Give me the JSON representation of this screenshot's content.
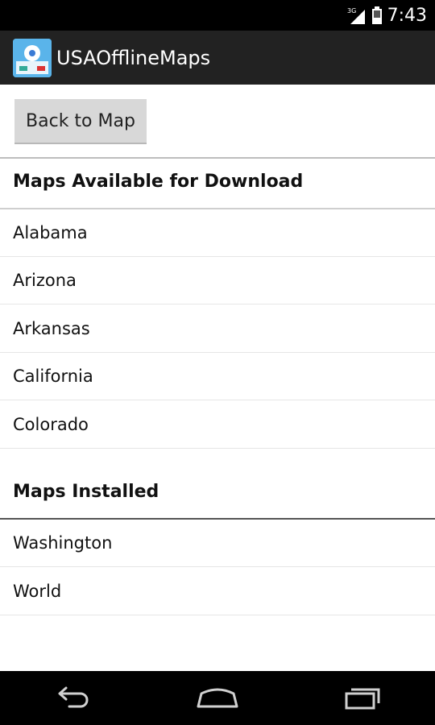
{
  "status_bar": {
    "network": "3G",
    "time": "7:43"
  },
  "action_bar": {
    "title": "USAOfflineMaps"
  },
  "back_button": {
    "label": "Back to Map"
  },
  "available": {
    "header": "Maps Available for Download",
    "items": [
      "Alabama",
      "Arizona",
      "Arkansas",
      "California",
      "Colorado"
    ]
  },
  "installed": {
    "header": "Maps Installed",
    "items": [
      "Washington",
      "World"
    ]
  },
  "nav": {
    "icons": [
      "back-icon",
      "home-icon",
      "recent-apps-icon"
    ]
  }
}
